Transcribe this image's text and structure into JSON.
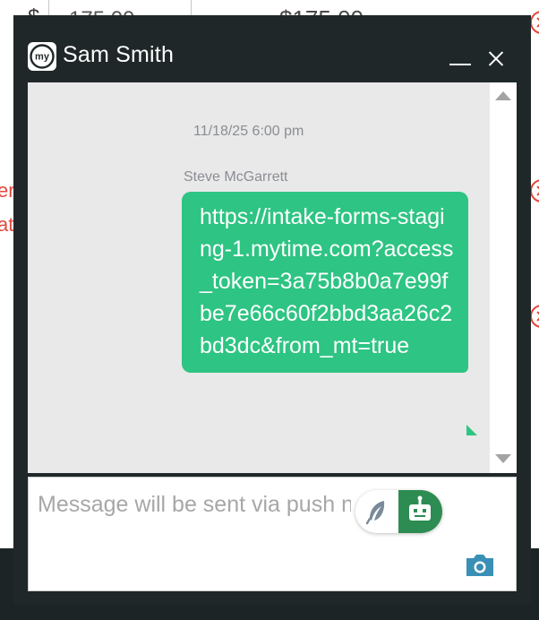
{
  "background": {
    "currency_symbol": "$",
    "quantity_value": "175.00",
    "total_value": "$175.00",
    "partial_texts": [
      "ers",
      "ati"
    ],
    "bar_name": "Sam Smith"
  },
  "chat": {
    "title": "Sam Smith",
    "logo_text": "my",
    "timestamp": "11/18/25 6:00 pm",
    "sender": "Steve McGarrett",
    "message": "https://intake-forms-staging-1.mytime.com?access_token=3a75b8b0a7e99fbe7e66c60f2bbd3aa26c2bd3dc&from_mt=true",
    "input_placeholder": "Message will be sent via push notification"
  },
  "icons": {
    "logo": "mytime-logo-icon",
    "minimize": "minimize-icon",
    "close": "close-icon",
    "scroll_up": "arrow-up-icon",
    "scroll_down": "arrow-down-icon",
    "feather": "feather-icon",
    "robot": "robot-icon",
    "camera": "camera-icon",
    "remove": "remove-circle-icon"
  },
  "colors": {
    "header_bg": "#1f2729",
    "bubble_bg": "#2ec483",
    "toggle_active": "#2d8c52",
    "camera": "#3a8fb7",
    "danger": "#e5443a"
  }
}
